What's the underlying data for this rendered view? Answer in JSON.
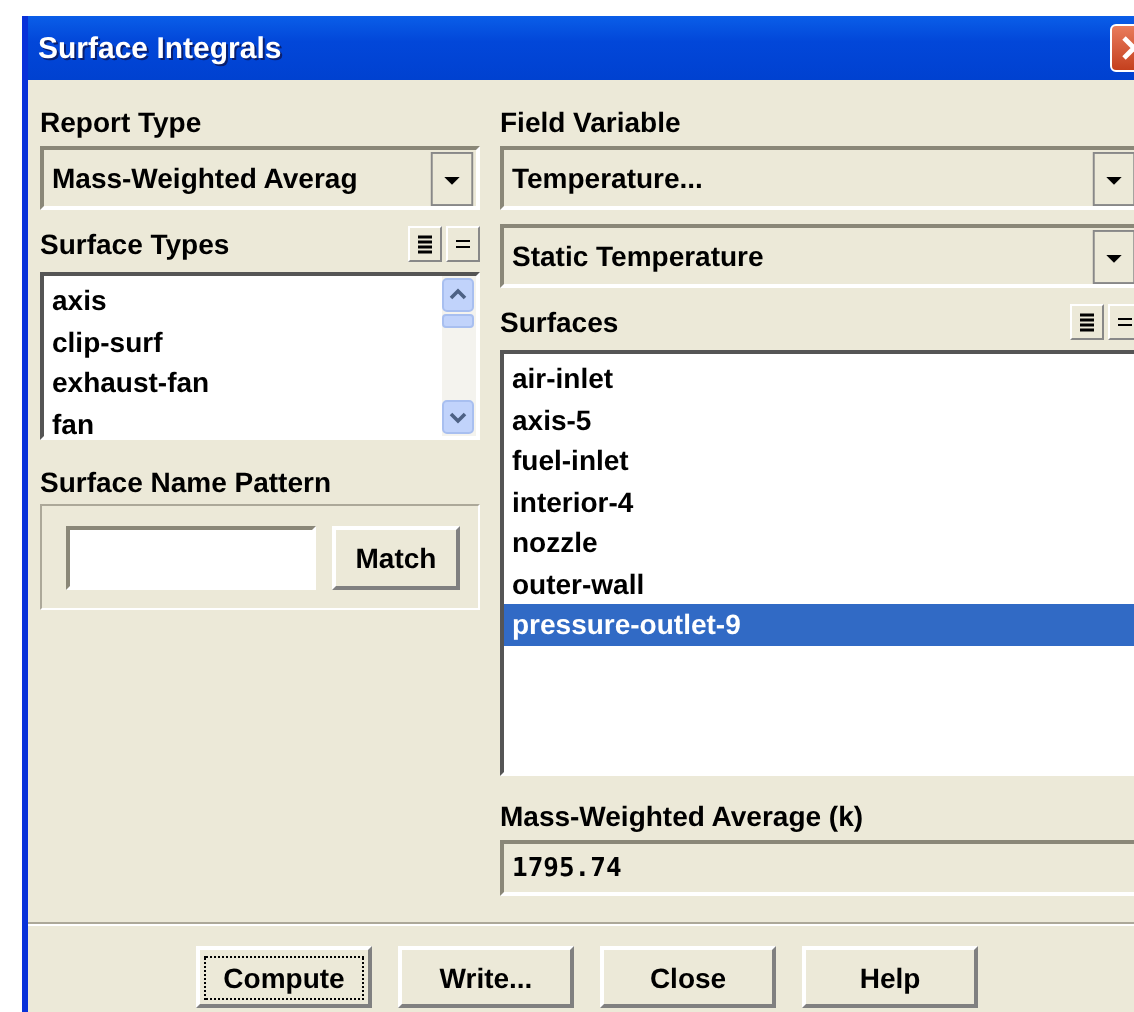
{
  "window": {
    "title": "Surface Integrals"
  },
  "report_type": {
    "label": "Report Type",
    "value": "Mass-Weighted Averag"
  },
  "surface_types": {
    "label": "Surface Types",
    "items": [
      {
        "label": "axis",
        "selected": false
      },
      {
        "label": "clip-surf",
        "selected": false
      },
      {
        "label": "exhaust-fan",
        "selected": false
      },
      {
        "label": "fan",
        "selected": false
      }
    ]
  },
  "surface_name_pattern": {
    "label": "Surface Name Pattern",
    "button": "Match"
  },
  "field_variable": {
    "label": "Field Variable",
    "value": "Temperature...",
    "subvalue": "Static Temperature"
  },
  "surfaces": {
    "label": "Surfaces",
    "items": [
      {
        "label": "air-inlet",
        "selected": false
      },
      {
        "label": "axis-5",
        "selected": false
      },
      {
        "label": "fuel-inlet",
        "selected": false
      },
      {
        "label": "interior-4",
        "selected": false
      },
      {
        "label": "nozzle",
        "selected": false
      },
      {
        "label": "outer-wall",
        "selected": false
      },
      {
        "label": "pressure-outlet-9",
        "selected": true
      }
    ]
  },
  "result": {
    "label": "Mass-Weighted Average (k)",
    "value": "1795.74"
  },
  "buttons": [
    {
      "label": "Compute",
      "focused": true
    },
    {
      "label": "Write...",
      "focused": false
    },
    {
      "label": "Close",
      "focused": false
    },
    {
      "label": "Help",
      "focused": false
    }
  ]
}
